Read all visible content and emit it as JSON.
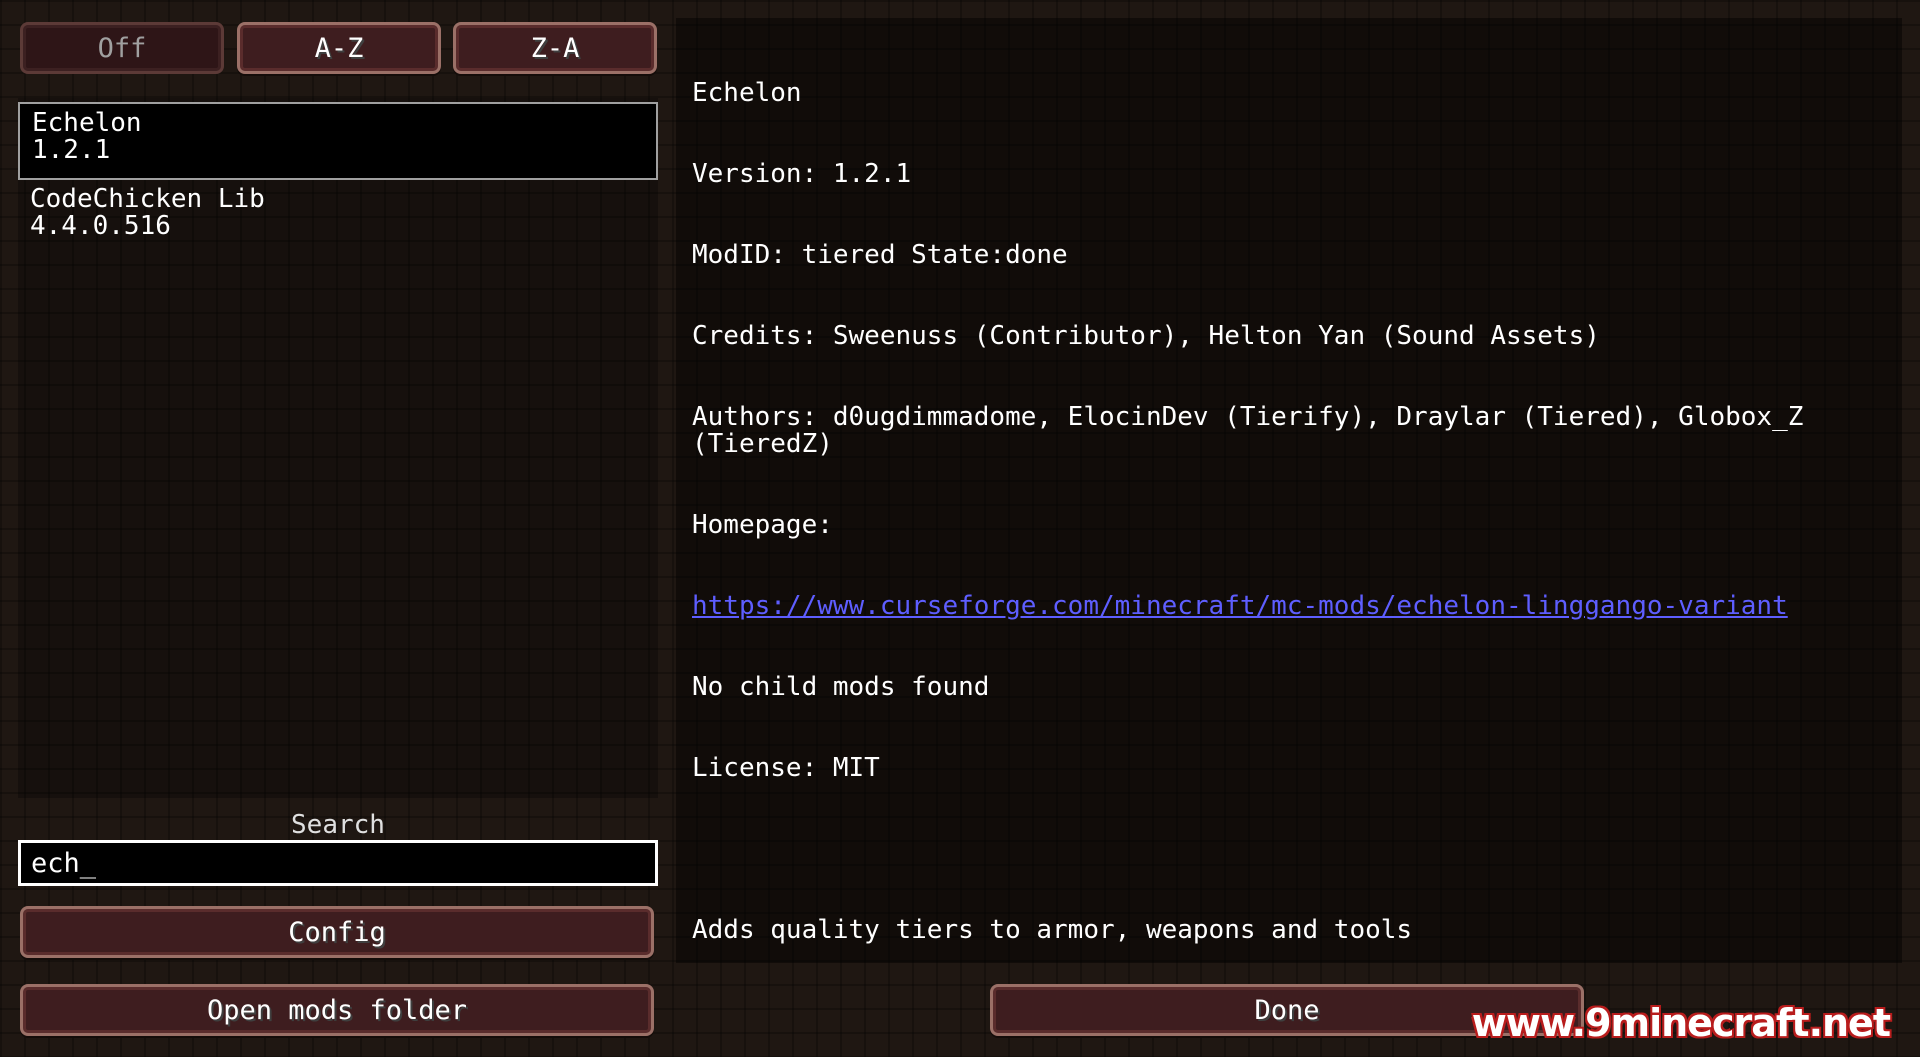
{
  "toolbar": {
    "sort_off_label": "Off",
    "sort_az_label": "A-Z",
    "sort_za_label": "Z-A"
  },
  "mod_list": [
    {
      "name": "Echelon",
      "version": "1.2.1",
      "selected": true
    },
    {
      "name": "CodeChicken Lib",
      "version": "4.4.0.516",
      "selected": false
    }
  ],
  "search": {
    "label": "Search",
    "value": "ech_"
  },
  "buttons": {
    "config_label": "Config",
    "open_mods_folder_label": "Open mods folder",
    "done_label": "Done"
  },
  "details": {
    "title": "Echelon",
    "version_line": "Version: 1.2.1",
    "modid_line": "ModID: tiered State:done",
    "credits_line": "Credits: Sweenuss (Contributor), Helton Yan (Sound Assets)",
    "authors_line": "Authors: d0ugdimmadome, ElocinDev (Tierify), Draylar (Tiered), Globox_Z (TieredZ)",
    "homepage_label": "Homepage:",
    "homepage_url": "https://www.curseforge.com/minecraft/mc-mods/echelon-linggango-variant",
    "child_mods_line": "No child mods found",
    "license_line": "License: MIT",
    "description": "Adds quality tiers to armor, weapons and tools"
  },
  "watermark": "www.9minecraft.net",
  "colors": {
    "background": "#1f1712",
    "button_fill": "#3e1d1f",
    "button_border": "#9b7067",
    "link": "#5e5eff",
    "watermark_outline": "#b81c1c"
  }
}
